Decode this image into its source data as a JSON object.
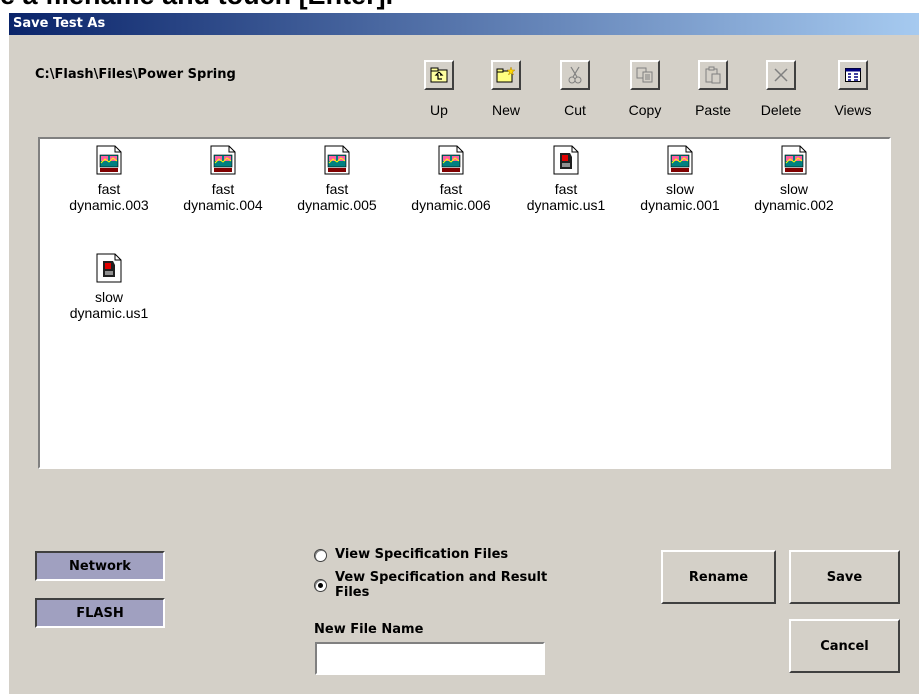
{
  "caption": "e a filename and touch [Enter].",
  "window": {
    "title": "Save Test As"
  },
  "path": "C:\\Flash\\Files\\Power Spring",
  "toolbar": [
    {
      "label": "Up",
      "icon": "folder-up-icon",
      "enabled": true
    },
    {
      "label": "New",
      "icon": "new-folder-icon",
      "enabled": true
    },
    {
      "label": "Cut",
      "icon": "scissors-icon",
      "enabled": false
    },
    {
      "label": "Copy",
      "icon": "copy-icon",
      "enabled": false
    },
    {
      "label": "Paste",
      "icon": "paste-icon",
      "enabled": false
    },
    {
      "label": "Delete",
      "icon": "delete-icon",
      "enabled": false
    },
    {
      "label": "Views",
      "icon": "views-icon",
      "enabled": true
    }
  ],
  "files": [
    {
      "line1": "fast",
      "line2": "dynamic.003",
      "icon": "chart-file-icon"
    },
    {
      "line1": "fast",
      "line2": "dynamic.004",
      "icon": "chart-file-icon"
    },
    {
      "line1": "fast",
      "line2": "dynamic.005",
      "icon": "chart-file-icon"
    },
    {
      "line1": "fast",
      "line2": "dynamic.006",
      "icon": "chart-file-icon"
    },
    {
      "line1": "fast",
      "line2": "dynamic.us1",
      "icon": "spec-file-icon"
    },
    {
      "line1": "slow",
      "line2": "dynamic.001",
      "icon": "chart-file-icon"
    },
    {
      "line1": "slow",
      "line2": "dynamic.002",
      "icon": "chart-file-icon"
    },
    {
      "line1": "slow",
      "line2": "dynamic.us1",
      "icon": "spec-file-icon"
    }
  ],
  "buttons": {
    "network": "Network",
    "flash": "FLASH",
    "rename": "Rename",
    "save": "Save",
    "cancel": "Cancel"
  },
  "filter": {
    "option1": "View Specification Files",
    "option2": "Vew Specification and Result Files",
    "selected": 2
  },
  "new_file": {
    "label": "New File Name",
    "value": ""
  },
  "colors": {
    "title_start": "#0a246a",
    "title_end": "#a6caf0",
    "face": "#d4d0c8",
    "drive_button": "#a0a0c0"
  }
}
